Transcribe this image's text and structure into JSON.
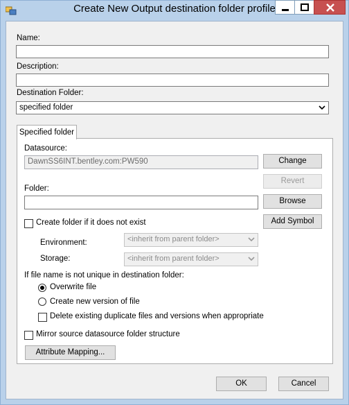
{
  "window": {
    "title": "Create New Output destination folder profile",
    "caption_buttons": {
      "minimize": "minimize-icon",
      "maximize": "maximize-icon",
      "close": "close-icon"
    }
  },
  "form": {
    "name_label": "Name:",
    "name_value": "",
    "description_label": "Description:",
    "description_value": "",
    "destination_label": "Destination Folder:",
    "destination_value": "specified folder"
  },
  "tab": {
    "label": "Specified folder",
    "datasource_label": "Datasource:",
    "datasource_value": "DawnSS6INT.bentley.com:PW590",
    "change_button": "Change",
    "revert_button": "Revert",
    "folder_label": "Folder:",
    "folder_value": "",
    "browse_button": "Browse",
    "create_folder_label": "Create folder if it does not exist",
    "create_folder_checked": false,
    "add_symbol_button": "Add Symbol",
    "environment_label": "Environment:",
    "environment_value": "<inherit from parent folder>",
    "storage_label": "Storage:",
    "storage_value": "<inherit from parent folder>",
    "unique_label": "If file name is not unique in destination folder:",
    "options": [
      {
        "label": "Overwrite file",
        "selected": true
      },
      {
        "label": "Create new version of file",
        "selected": false
      }
    ],
    "delete_duplicates_label": "Delete existing duplicate files and versions when appropriate",
    "delete_duplicates_checked": false,
    "mirror_label": "Mirror source datasource folder structure",
    "mirror_checked": false,
    "attribute_mapping_button": "Attribute Mapping..."
  },
  "footer": {
    "ok_button": "OK",
    "cancel_button": "Cancel"
  },
  "colors": {
    "title_bar": "#b9d1ea",
    "close_button": "#c75050",
    "dialog_background": "#f0f0f0"
  }
}
